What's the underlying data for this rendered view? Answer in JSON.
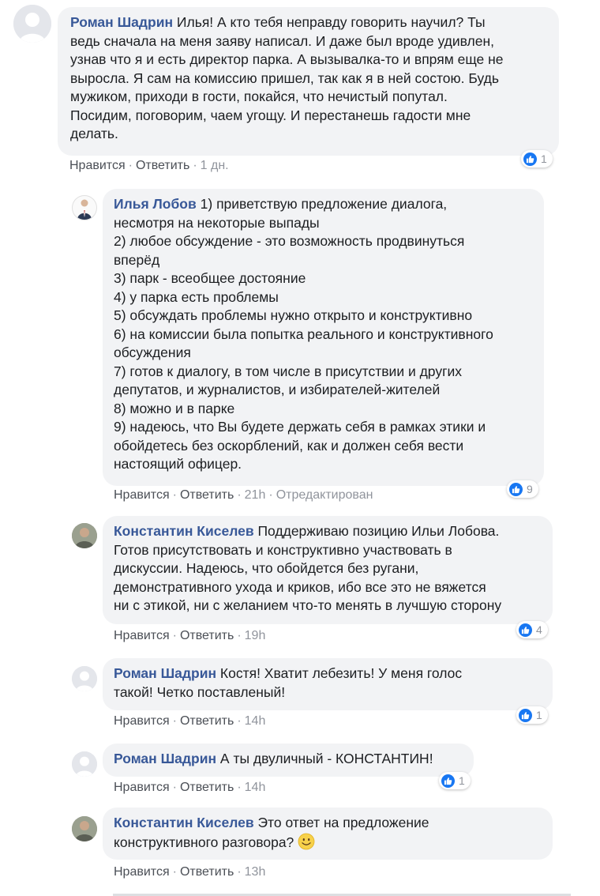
{
  "comments": [
    {
      "author": "Роман Шадрин",
      "text": "Илья! А кто тебя неправду говорить научил? Ты\nведь сначала на меня заяву написал. И даже был вроде удивлен,\nузнав что я и есть директор парка. А вызывалка-то и впрям еще не\nвыросла. Я сам на комиссию пришел, так как я в ней состою. Будь\nмужиком, приходи в гости, покайся, что нечистый попутал.\nПосидим, поговорим, чаем угощу. И перестанешь гадости мне\nделать.",
      "like_label": "Нравится",
      "reply_label": "Ответить",
      "time": "1 дн.",
      "edited": "",
      "reactions": "1"
    },
    {
      "author": "Илья Лобов",
      "text": "1) приветствую предложение диалога,\nнесмотря на некоторые выпады\n2) любое обсуждение - это возможность продвинуться\nвперёд\n3) парк - всеобщее достояние\n4) у парка есть проблемы\n5) обсуждать проблемы нужно открыто и конструктивно\n6) на комиссии была попытка реального и конструктивного\nобсуждения\n7) готов к диалогу, в том числе в присутствии и других\nдепутатов, и журналистов, и избирателей-жителей\n8) можно и в парке\n9) надеюсь, что Вы будете держать себя в рамках этики и\nобойдетесь без оскорблений, как и должен себя вести\nнастоящий офицер.",
      "like_label": "Нравится",
      "reply_label": "Ответить",
      "time": "21h",
      "edited": "Отредактирован",
      "reactions": "9"
    },
    {
      "author": "Константин Киселев",
      "text": "Поддерживаю позицию Ильи Лобова.\nГотов присутствовать и конструктивно участвовать в\nдискуссии. Надеюсь, что обойдется без ругани,\nдемонстративного ухода и криков, ибо все это не вяжется\nни с этикой, ни с желанием что-то менять в лучшую сторону",
      "like_label": "Нравится",
      "reply_label": "Ответить",
      "time": "19h",
      "edited": "",
      "reactions": "4"
    },
    {
      "author": "Роман Шадрин",
      "text": "Костя! Хватит лебезить! У меня голос\nтакой! Четко поставленый!",
      "like_label": "Нравится",
      "reply_label": "Ответить",
      "time": "14h",
      "edited": "",
      "reactions": "1"
    },
    {
      "author": "Роман Шадрин",
      "text": "А ты двуличный - КОНСТАНТИН!",
      "like_label": "Нравится",
      "reply_label": "Ответить",
      "time": "14h",
      "edited": "",
      "reactions": "1"
    },
    {
      "author": "Константин Киселев",
      "text": "Это ответ на предложение\nконструктивного разговора?",
      "like_label": "Нравится",
      "reply_label": "Ответить",
      "time": "13h",
      "edited": "",
      "reactions": ""
    }
  ],
  "colors": {
    "author": "#385898",
    "bubble": "#f2f3f5",
    "like_icon": "#1877f2",
    "meta": "#90949c"
  }
}
